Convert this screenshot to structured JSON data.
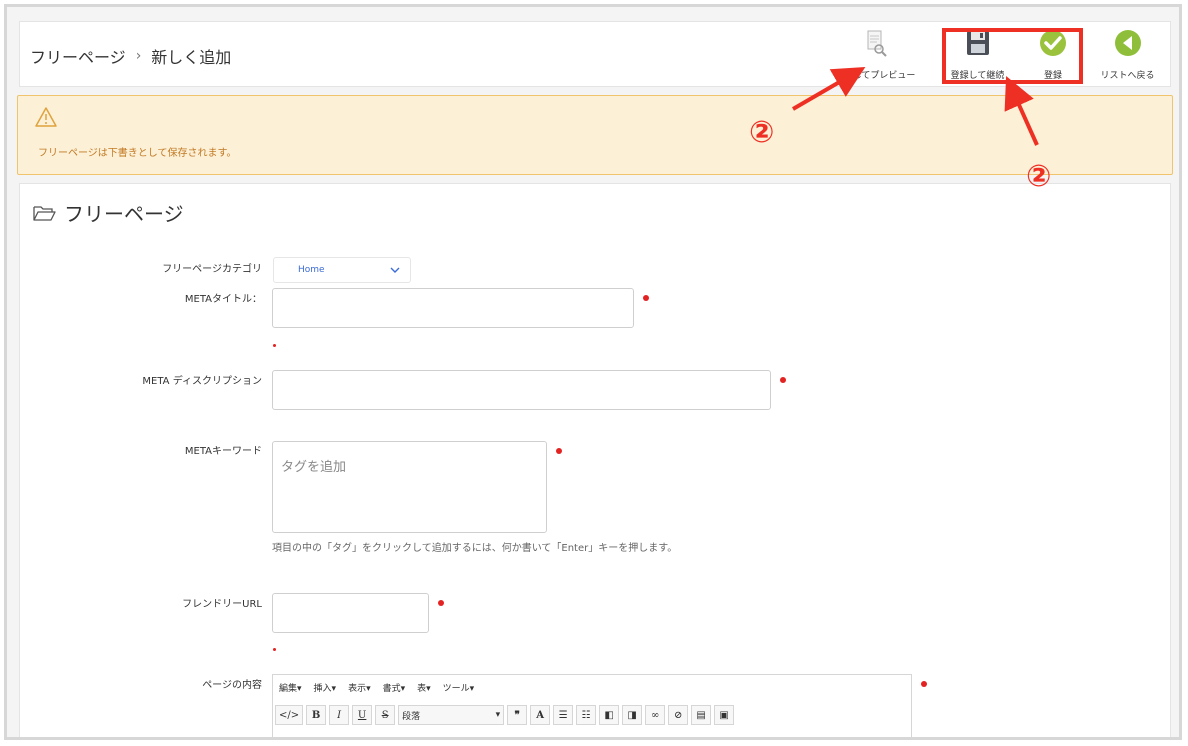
{
  "header": {
    "breadcrumb": [
      "フリーページ",
      "新しく追加"
    ],
    "separator": "›",
    "toolbar": {
      "preview_label": "登録してプレビュー",
      "save_continue_label": "登録して継続",
      "save_label": "登録",
      "back_label": "リストへ戻る"
    }
  },
  "alert": {
    "message": "フリーページは下書きとして保存されます。"
  },
  "panel": {
    "title": "フリーページ"
  },
  "form": {
    "category_label": "フリーページカテゴリ",
    "category_value": "Home",
    "meta_title_label": "METAタイトル：",
    "meta_description_label": "META ディスクリプション",
    "meta_keyword_label": "METAキーワード",
    "meta_keyword_placeholder": "タグを追加",
    "meta_keyword_help": "項目の中の「タグ」をクリックして追加するには、何か書いて「Enter」キーを押します。",
    "friendly_url_label": "フレンドリーURL",
    "content_label": "ページの内容"
  },
  "editor": {
    "menu": [
      "編集▾",
      "挿入▾",
      "表示▾",
      "書式▾",
      "表▾",
      "ツール▾"
    ],
    "format_select": "段落"
  },
  "annotations": {
    "number_1": "②",
    "number_2": "②",
    "color": "#ee3024"
  }
}
